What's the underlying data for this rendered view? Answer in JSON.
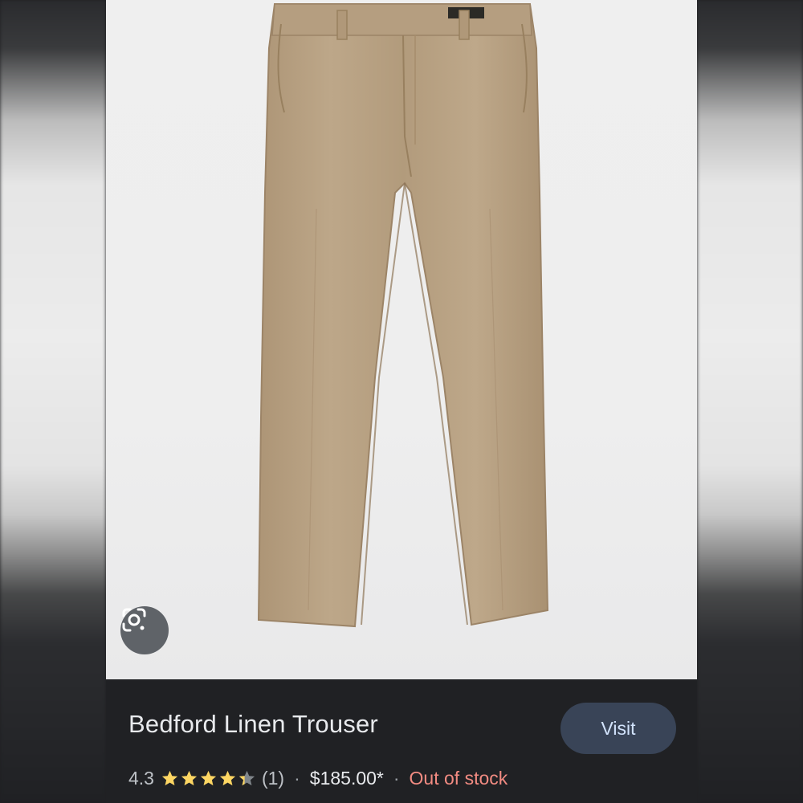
{
  "product": {
    "title": "Bedford Linen Trouser",
    "rating": "4.3",
    "rating_value": 4.3,
    "rating_max": 5,
    "review_count": "(1)",
    "price": "$185.00*",
    "availability": "Out of stock",
    "visit_label": "Visit",
    "lens_icon": "google-lens-icon"
  },
  "colors": {
    "star": "#fdd663",
    "star_empty": "#80868b",
    "stock": "#f28b82",
    "visit_bg": "#394457",
    "visit_text": "#d2e3fc",
    "trouser": "#b8a184"
  },
  "separator": "·"
}
